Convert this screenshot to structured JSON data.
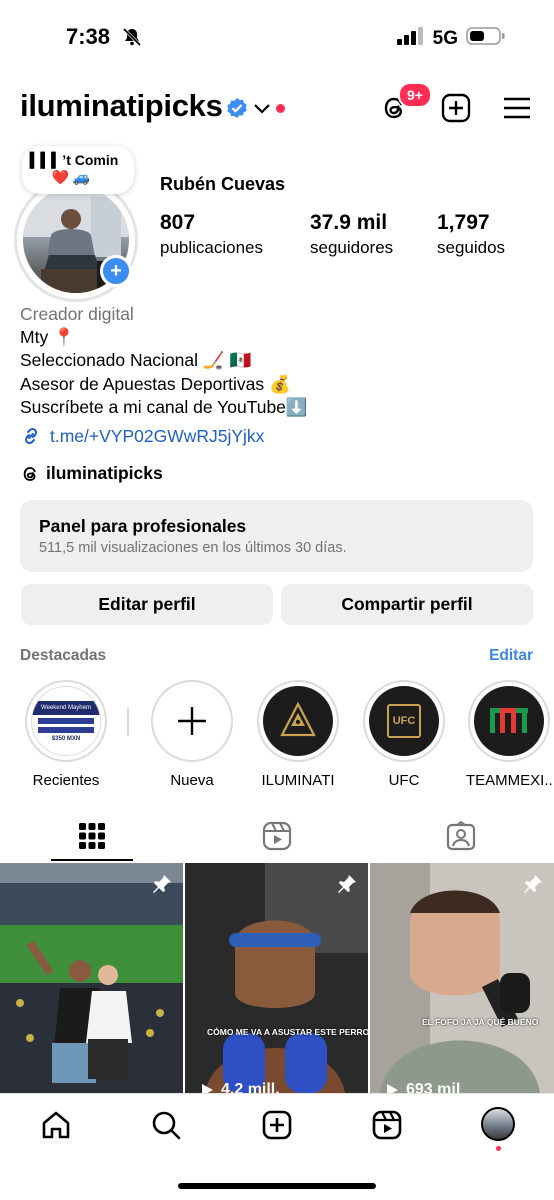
{
  "status": {
    "time": "7:38",
    "network": "5G"
  },
  "header": {
    "username": "iluminatipicks",
    "threads_badge": "9+"
  },
  "profile": {
    "note": "▍▍▍’t Comin",
    "note_emojis": "❤️ 🚙",
    "name": "Rubén Cuevas",
    "stats": [
      {
        "value": "807",
        "label": "publicaciones"
      },
      {
        "value": "37.9 mil",
        "label": "seguidores"
      },
      {
        "value": "1,797",
        "label": "seguidos"
      }
    ],
    "bio": {
      "category": "Creador digital",
      "lines": [
        "Mty 📍",
        "Seleccionado Nacional 🏒 🇲🇽",
        "Asesor de Apuestas Deportivas 💰",
        "Suscríbete a mi canal de YouTube⬇️"
      ]
    },
    "link": "t.me/+VYP02GWwRJ5jYjkx",
    "threads_handle": "iluminatipicks"
  },
  "panel": {
    "title": "Panel para profesionales",
    "subtitle": "511,5 mil visualizaciones en los últimos 30 días."
  },
  "buttons": {
    "edit": "Editar perfil",
    "share": "Compartir perfil"
  },
  "highlights": {
    "title": "Destacadas",
    "edit_label": "Editar",
    "items": [
      {
        "label": "Recientes",
        "thumb_text": "Weekend Mayhem",
        "thumb_value": "$350 MXN"
      },
      {
        "label": "Nueva"
      },
      {
        "label": "ILUMINATI"
      },
      {
        "label": "UFC",
        "thumb_text": "UFC"
      },
      {
        "label": "TEAMMEXI..."
      }
    ]
  },
  "posts": [
    {
      "caption": "",
      "views": ""
    },
    {
      "caption": "CÓMO ME VA A ASUSTAR ESTE PERRO DIJE YO",
      "views": "4.2 mill."
    },
    {
      "caption": "EL FOFO JA JA QUÉ BUENO",
      "views": "693 mil"
    }
  ],
  "colors": {
    "accent": "#3a85e6",
    "badge": "#ff2d55",
    "link": "#2060c8",
    "verified": "#3b8ef0"
  }
}
